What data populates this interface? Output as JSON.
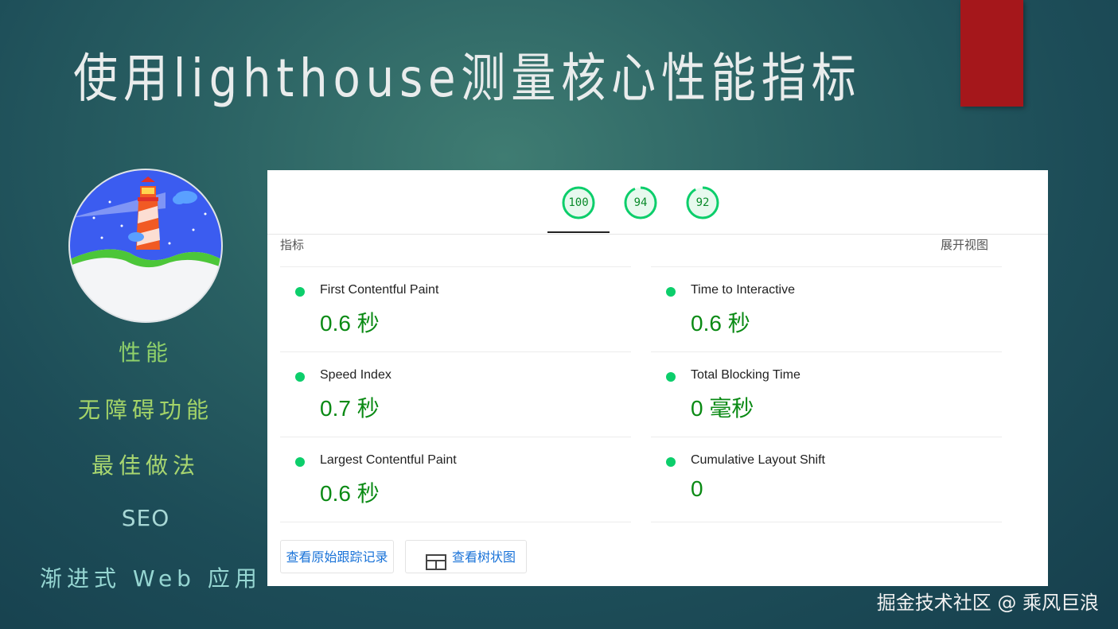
{
  "slide": {
    "title": "使用lighthouse测量核心性能指标",
    "watermark": "掘金技术社区 @ 乘风巨浪"
  },
  "categories": [
    "性能",
    "无障碍功能",
    "最佳做法",
    "SEO",
    "渐进式 Web 应用"
  ],
  "report": {
    "scores": [
      {
        "value": "100",
        "fraction": 1.0
      },
      {
        "value": "94",
        "fraction": 0.94
      },
      {
        "value": "92",
        "fraction": 0.92
      }
    ],
    "metrics_heading": "指标",
    "expand_label": "展开视图",
    "metrics_left": [
      {
        "label": "First Contentful Paint",
        "value": "0.6 秒"
      },
      {
        "label": "Speed Index",
        "value": "0.7 秒"
      },
      {
        "label": "Largest Contentful Paint",
        "value": "0.6 秒"
      }
    ],
    "metrics_right": [
      {
        "label": "Time to Interactive",
        "value": "0.6 秒"
      },
      {
        "label": "Total Blocking Time",
        "value": "0 毫秒"
      },
      {
        "label": "Cumulative Layout Shift",
        "value": "0"
      }
    ],
    "buttons": {
      "view_trace": "查看原始跟踪记录",
      "view_treemap": "查看树状图"
    }
  },
  "colors": {
    "pass_green": "#0cce6b",
    "value_green": "#0a8a14",
    "link_blue": "#1a73d8",
    "accent_red": "#a5171b"
  },
  "icons": [
    "lighthouse-logo-icon",
    "treemap-icon",
    "status-dot-icon"
  ]
}
